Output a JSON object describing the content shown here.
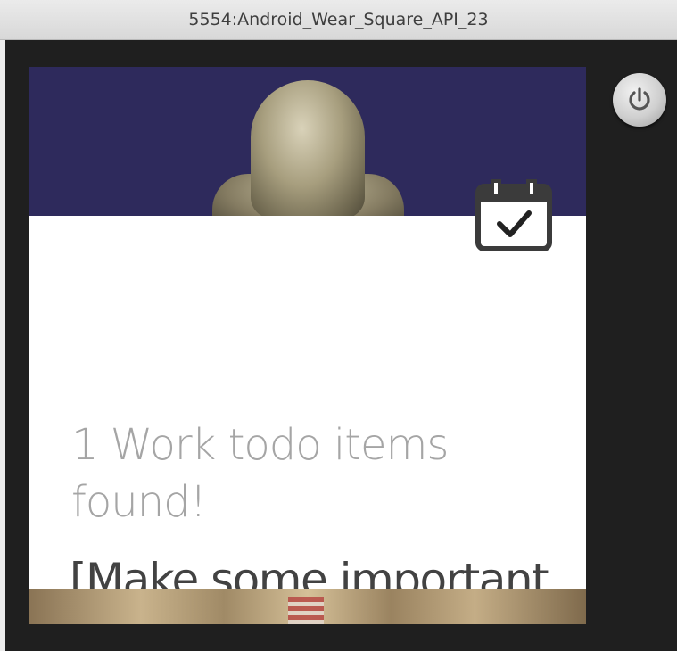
{
  "window": {
    "title": "5554:Android_Wear_Square_API_23"
  },
  "notification": {
    "title": "1 Work todo items found!",
    "text": "[Make some important decisions]",
    "icon": "calendar-check-icon"
  },
  "controls": {
    "power_icon": "power-icon"
  },
  "colors": {
    "emulator_frame": "#1f1f1f",
    "card_background": "#ffffff",
    "title_text": "#a5a5a5",
    "body_text": "#424242",
    "wallpaper_sky": "#2e2a5c"
  }
}
